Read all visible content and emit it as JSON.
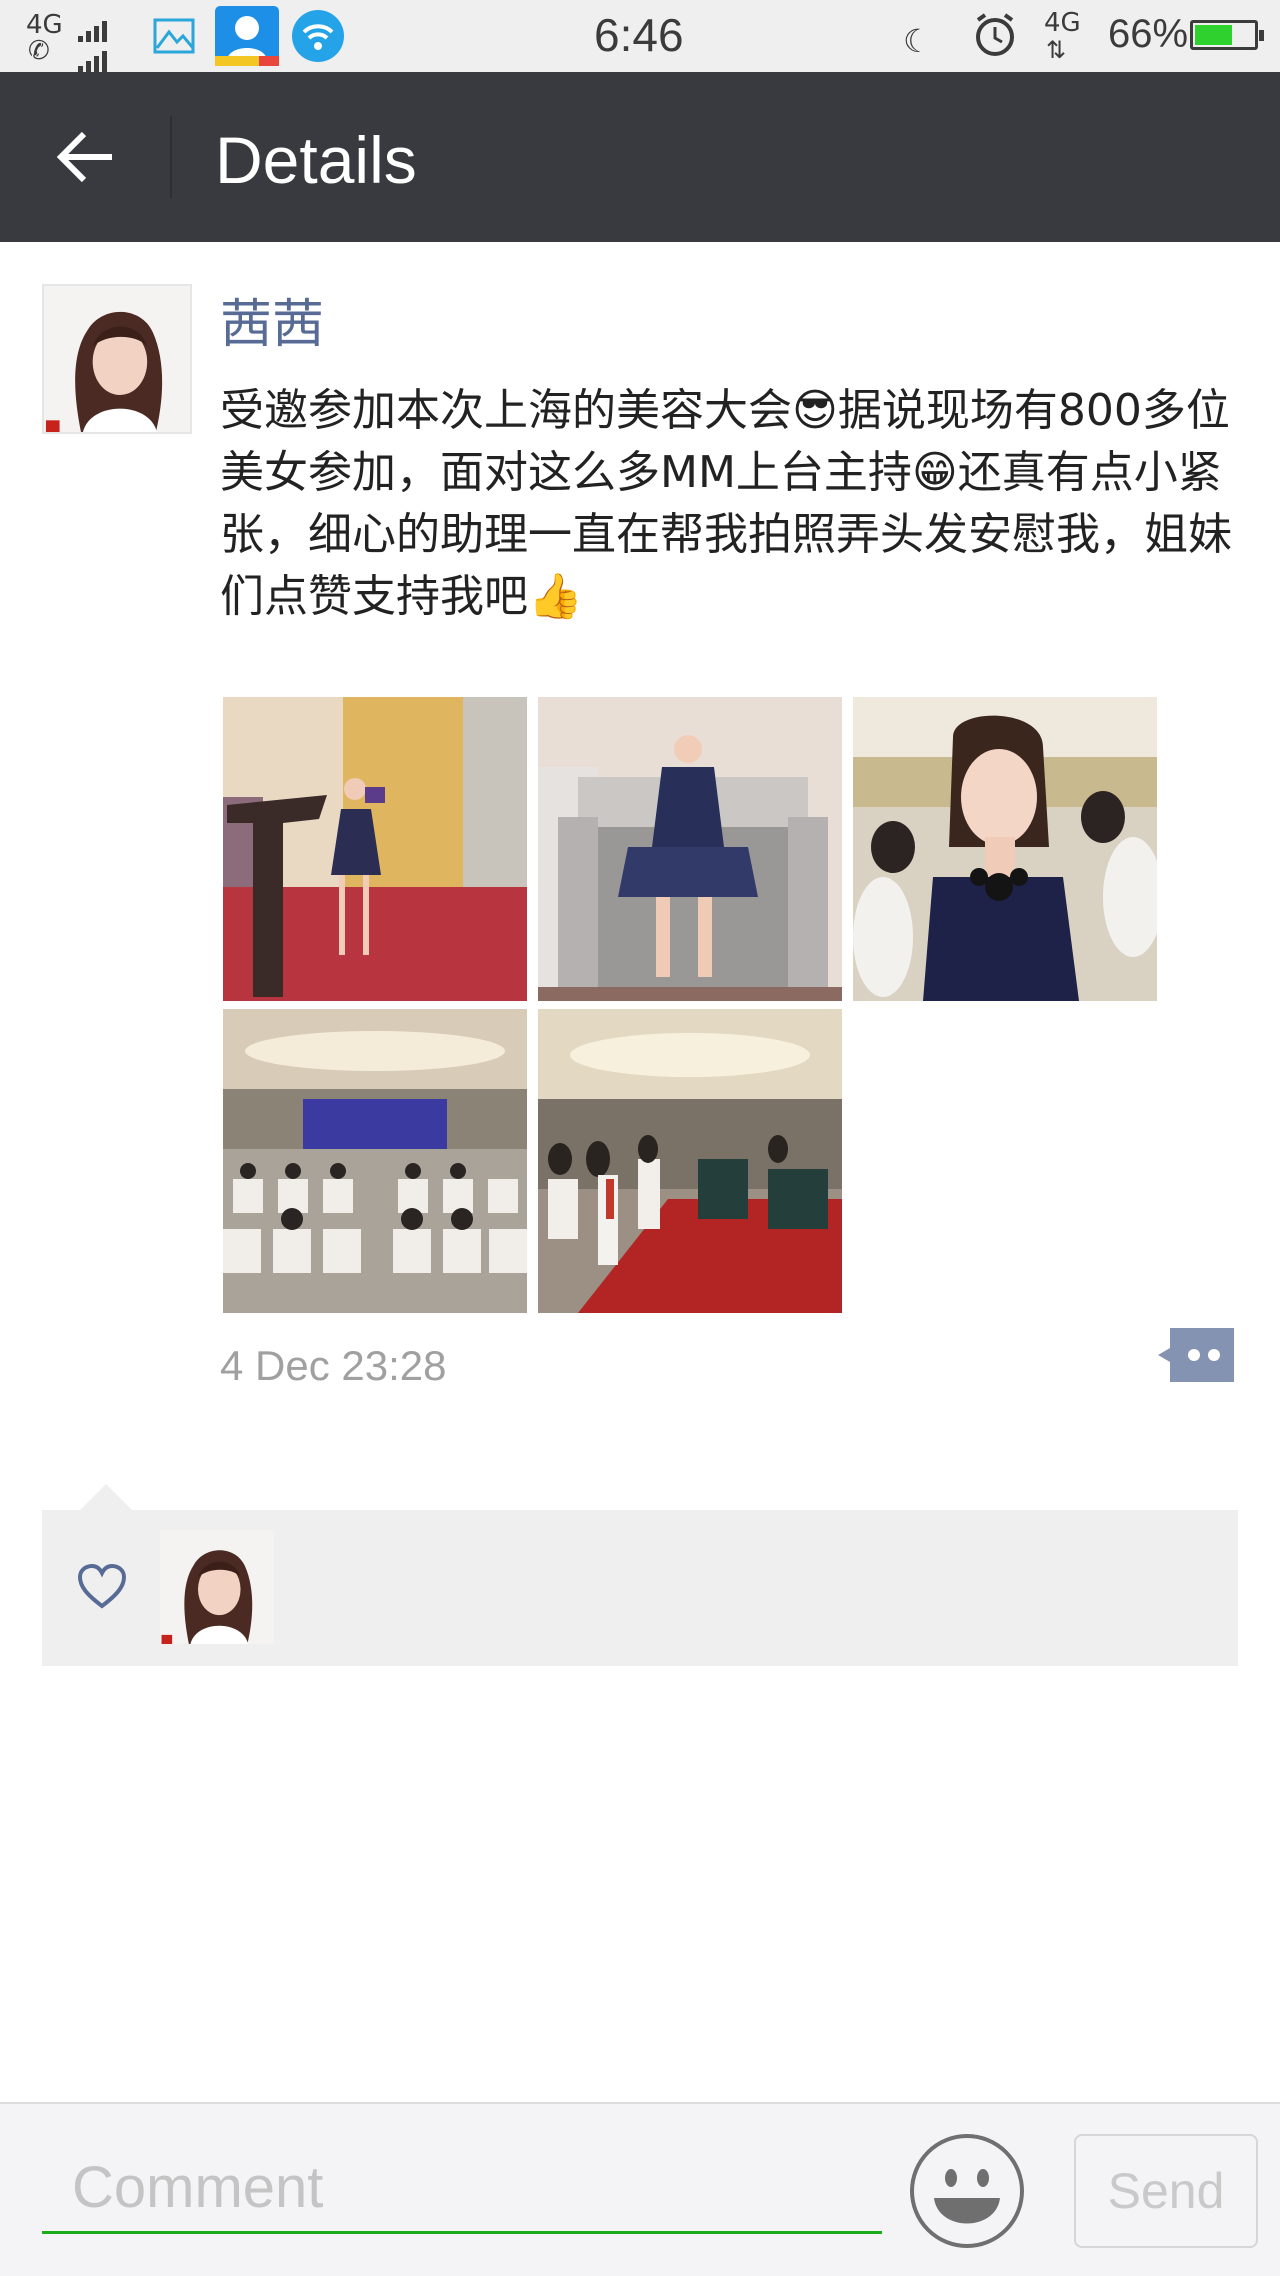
{
  "status_bar": {
    "network_label": "4G",
    "time": "6:46",
    "data_label": "4G",
    "battery_text": "66%",
    "battery_level": 0.66,
    "battery_color": "#2fd12f"
  },
  "header": {
    "back_icon": "arrow-left-icon",
    "title": "Details",
    "background": "#393a3f"
  },
  "post": {
    "author": "茜茜",
    "author_color": "#576b95",
    "text": "受邀参加本次上海的美容大会😎据说现场有800多位美女参加，面对这么多MM上台主持😁还真有点小紧张，细心的助理一直在帮我拍照弄头发安慰我，姐妹们点赞支持我吧👍",
    "photos": [
      {
        "icon": "photo-stage-speech"
      },
      {
        "icon": "photo-seated-dress"
      },
      {
        "icon": "photo-selfie-hall"
      },
      {
        "icon": "photo-conference-hall"
      },
      {
        "icon": "photo-audience-red-carpet"
      }
    ],
    "timestamp": "4 Dec 23:28",
    "comment_icon": "comment-dots-icon"
  },
  "likes": {
    "heart_icon": "heart-outline-icon",
    "users": [
      {
        "avatar_icon": "avatar-photo"
      }
    ]
  },
  "comment_bar": {
    "placeholder": "Comment",
    "emoji_icon": "smiley-icon",
    "send_label": "Send",
    "accent": "#1aad19"
  }
}
